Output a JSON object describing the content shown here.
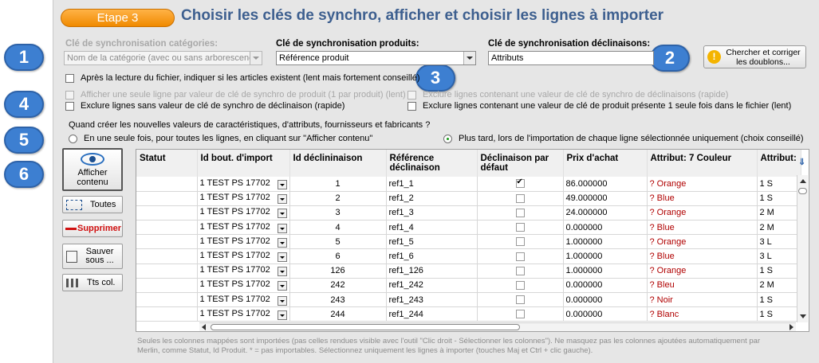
{
  "header": {
    "step": "Etape 3",
    "title": "Choisir les clés de synchro, afficher et choisir les lignes à importer"
  },
  "keys": {
    "categories": {
      "label": "Clé de synchronisation catégories:",
      "value": "Nom de la catégorie (avec ou sans arborescence)"
    },
    "products": {
      "label": "Clé de synchronisation produits:",
      "value": "Référence produit"
    },
    "declinaisons": {
      "label": "Clé de synchronisation déclinaisons:",
      "value": "Attributs"
    }
  },
  "search_button": {
    "label": "Chercher et corriger les doublons..."
  },
  "badges": [
    "1",
    "2",
    "3",
    "4",
    "5",
    "6"
  ],
  "options": {
    "check_exist": "Après la lecture du fichier, indiquer si les articles existent (lent mais fortement conseillé)",
    "one_line_per_value": "Afficher une seule ligne par valeur de clé de synchro de produit (1 par produit) (lent)",
    "exclude_without_value": "Exclure lignes sans valeur de clé de synchro de déclinaison (rapide)",
    "exclude_with_value": "Exclure lignes contenant une valeur de clé de synchro de déclinaisons (rapide)",
    "exclude_once": "Exclure lignes contenant une valeur de clé de produit présente 1 seule fois dans le fichier (lent)"
  },
  "creation": {
    "question": "Quand créer les nouvelles valeurs de caractéristiques, d'attributs, fournisseurs et fabricants ?",
    "option_once": "En une seule fois, pour toutes les lignes, en cliquant sur \"Afficher contenu\"",
    "option_later": "Plus tard, lors de l'importation de chaque ligne sélectionnée uniquement (choix conseillé)"
  },
  "side_buttons": {
    "afficher": "Afficher contenu",
    "toutes": "Toutes",
    "supprimer": "Supprimer",
    "sauver": "Sauver sous ...",
    "tts_col": "Tts col."
  },
  "table": {
    "columns": [
      "Statut",
      "Id bout. d'import",
      "Id déclininaison",
      "Référence déclinaison",
      "Déclinaison par défaut",
      "Prix d'achat",
      "Attribut: 7 Couleur",
      "Attribut:"
    ],
    "rows": [
      {
        "id_import": "1 TEST PS 17702",
        "id_decl": "1",
        "ref": "ref1_1",
        "default": true,
        "prix": "86.000000",
        "couleur": "? Orange",
        "taille": "1 S"
      },
      {
        "id_import": "1 TEST PS 17702",
        "id_decl": "2",
        "ref": "ref1_2",
        "default": false,
        "prix": "49.000000",
        "couleur": "? Blue",
        "taille": "1 S"
      },
      {
        "id_import": "1 TEST PS 17702",
        "id_decl": "3",
        "ref": "ref1_3",
        "default": false,
        "prix": "24.000000",
        "couleur": "? Orange",
        "taille": "2 M"
      },
      {
        "id_import": "1 TEST PS 17702",
        "id_decl": "4",
        "ref": "ref1_4",
        "default": false,
        "prix": "0.000000",
        "couleur": "? Blue",
        "taille": "2 M"
      },
      {
        "id_import": "1 TEST PS 17702",
        "id_decl": "5",
        "ref": "ref1_5",
        "default": false,
        "prix": "1.000000",
        "couleur": "? Orange",
        "taille": "3 L"
      },
      {
        "id_import": "1 TEST PS 17702",
        "id_decl": "6",
        "ref": "ref1_6",
        "default": false,
        "prix": "1.000000",
        "couleur": "? Blue",
        "taille": "3 L"
      },
      {
        "id_import": "1 TEST PS 17702",
        "id_decl": "126",
        "ref": "ref1_126",
        "default": false,
        "prix": "1.000000",
        "couleur": "? Orange",
        "taille": "1 S"
      },
      {
        "id_import": "1 TEST PS 17702",
        "id_decl": "242",
        "ref": "ref1_242",
        "default": false,
        "prix": "0.000000",
        "couleur": "? Bleu",
        "taille": "2 M"
      },
      {
        "id_import": "1 TEST PS 17702",
        "id_decl": "243",
        "ref": "ref1_243",
        "default": false,
        "prix": "0.000000",
        "couleur": "? Noir",
        "taille": "1 S"
      },
      {
        "id_import": "1 TEST PS 17702",
        "id_decl": "244",
        "ref": "ref1_244",
        "default": false,
        "prix": "0.000000",
        "couleur": "? Blanc",
        "taille": "1 S"
      }
    ]
  },
  "footer": "Seules les colonnes mappées sont importées (pas celles rendues visible avec l'outil \"Clic droit - Sélectionner les colonnes\"). Ne masquez pas les colonnes ajoutées automatiquement par Merlin, comme Statut, Id Produit.  * = pas importables.  Sélectionnez uniquement les lignes à importer (touches Maj et Ctrl + clic gauche)."
}
